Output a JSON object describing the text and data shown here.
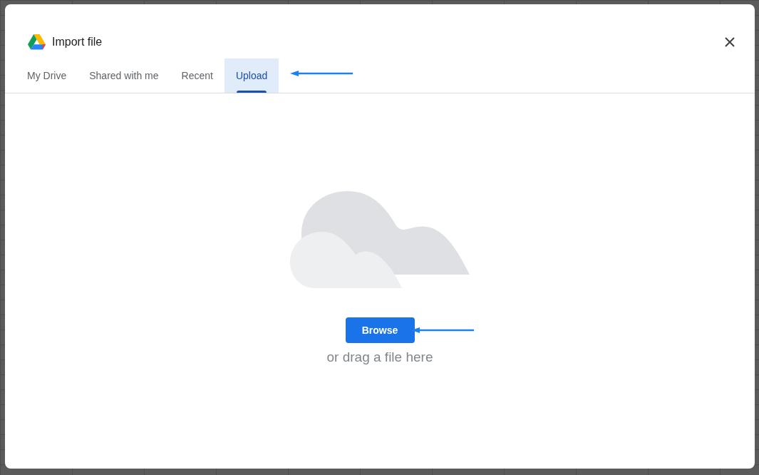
{
  "dialog": {
    "title": "Import file"
  },
  "tabs": [
    {
      "label": "My Drive",
      "selected": false
    },
    {
      "label": "Shared with me",
      "selected": false
    },
    {
      "label": "Recent",
      "selected": false
    },
    {
      "label": "Upload",
      "selected": true
    }
  ],
  "upload": {
    "button": "Browse",
    "hint": "or drag a file here"
  }
}
